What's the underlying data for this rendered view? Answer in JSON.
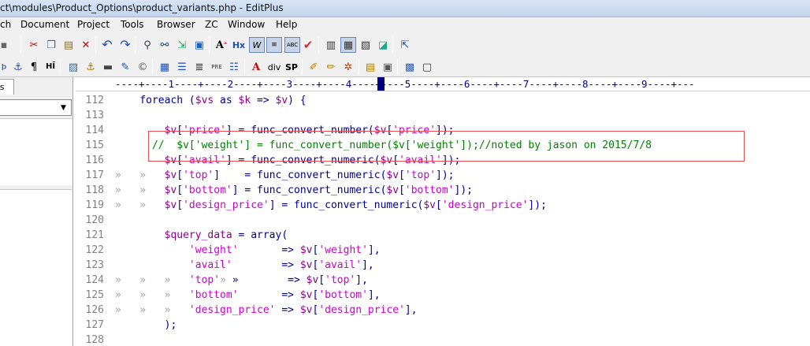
{
  "titlebar": {
    "title": "ct\\modules\\Product_Options\\product_variants.php - EditPlus"
  },
  "menu": [
    "ch",
    "Document",
    "Project",
    "Tools",
    "Browser",
    "ZC",
    "Window",
    "Help"
  ],
  "left_panel": {
    "tab_label": "ons"
  },
  "ruler": {
    "text": "----+----1----+----2----+----3----+----4----+----5----+----6----+----7----+----8----+----9----+---"
  },
  "code": {
    "lines": [
      {
        "num": "112",
        "tabs": "",
        "segs": [
          [
            "k",
            "    foreach ("
          ],
          [
            "v",
            "$vs"
          ],
          [
            "k",
            " as "
          ],
          [
            "v",
            "$k"
          ],
          [
            "k",
            " => "
          ],
          [
            "v",
            "$v"
          ],
          [
            "k",
            ") {"
          ]
        ]
      },
      {
        "num": "113",
        "tabs": "",
        "segs": []
      },
      {
        "num": "114",
        "tabs": "",
        "segs": [
          [
            "v",
            "        $v"
          ],
          [
            "k",
            "["
          ],
          [
            "str",
            "'price'"
          ],
          [
            "k",
            "] = func_convert_number("
          ],
          [
            "v",
            "$v"
          ],
          [
            "k",
            "["
          ],
          [
            "str",
            "'price'"
          ],
          [
            "k",
            "]);"
          ]
        ]
      },
      {
        "num": "115",
        "tabs": "",
        "segs": [
          [
            "c",
            "      //  $v['weight'] = func_convert_number($v['weight']);//noted by jason on 2015/7/8"
          ]
        ]
      },
      {
        "num": "116",
        "tabs": "",
        "segs": [
          [
            "v",
            "        $v"
          ],
          [
            "k",
            "["
          ],
          [
            "str",
            "'avail'"
          ],
          [
            "k",
            "] = func_convert_numeric("
          ],
          [
            "v",
            "$v"
          ],
          [
            "k",
            "["
          ],
          [
            "str",
            "'avail'"
          ],
          [
            "k",
            "]);"
          ]
        ]
      },
      {
        "num": "117",
        "tabs": "»   »",
        "segs": [
          [
            "v",
            "        $v"
          ],
          [
            "k",
            "["
          ],
          [
            "str",
            "'top'"
          ],
          [
            "k",
            "]    = func_convert_numeric("
          ],
          [
            "v",
            "$v"
          ],
          [
            "k",
            "["
          ],
          [
            "str",
            "'top'"
          ],
          [
            "k",
            "]);"
          ]
        ]
      },
      {
        "num": "118",
        "tabs": "»   »",
        "segs": [
          [
            "v",
            "        $v"
          ],
          [
            "k",
            "["
          ],
          [
            "str",
            "'bottom'"
          ],
          [
            "k",
            "] = func_convert_numeric("
          ],
          [
            "v",
            "$v"
          ],
          [
            "k",
            "["
          ],
          [
            "str",
            "'bottom'"
          ],
          [
            "k",
            "]);"
          ]
        ]
      },
      {
        "num": "119",
        "tabs": "»   »",
        "segs": [
          [
            "v",
            "        $v"
          ],
          [
            "k",
            "["
          ],
          [
            "str",
            "'design_price'"
          ],
          [
            "k",
            "] = func_convert_numeric("
          ],
          [
            "v",
            "$v"
          ],
          [
            "k",
            "["
          ],
          [
            "str",
            "'design_price'"
          ],
          [
            "k",
            "]);"
          ]
        ]
      },
      {
        "num": "120",
        "tabs": "",
        "segs": []
      },
      {
        "num": "121",
        "tabs": "",
        "segs": [
          [
            "v",
            "        $query_data"
          ],
          [
            "k",
            " = array("
          ]
        ]
      },
      {
        "num": "122",
        "tabs": "",
        "segs": [
          [
            "str",
            "            'weight'"
          ],
          [
            "k",
            "       => "
          ],
          [
            "v",
            "$v"
          ],
          [
            "k",
            "["
          ],
          [
            "str",
            "'weight'"
          ],
          [
            "k",
            "],"
          ]
        ]
      },
      {
        "num": "123",
        "tabs": "",
        "segs": [
          [
            "str",
            "            'avail'"
          ],
          [
            "k",
            "        => "
          ],
          [
            "v",
            "$v"
          ],
          [
            "k",
            "["
          ],
          [
            "str",
            "'avail'"
          ],
          [
            "k",
            "],"
          ]
        ]
      },
      {
        "num": "124",
        "tabs": "»   »   »",
        "segs": [
          [
            "str",
            "            'top'"
          ],
          [
            "tab",
            "» "
          ],
          [
            "k",
            "  »        => "
          ],
          [
            "v",
            "$v"
          ],
          [
            "k",
            "["
          ],
          [
            "str",
            "'top'"
          ],
          [
            "k",
            "],"
          ]
        ]
      },
      {
        "num": "125",
        "tabs": "»   »   »",
        "segs": [
          [
            "str",
            "            'bottom'"
          ],
          [
            "k",
            "       => "
          ],
          [
            "v",
            "$v"
          ],
          [
            "k",
            "["
          ],
          [
            "str",
            "'bottom'"
          ],
          [
            "k",
            "],"
          ]
        ]
      },
      {
        "num": "126",
        "tabs": "»   »   »",
        "segs": [
          [
            "str",
            "            'design_price'"
          ],
          [
            "k",
            " => "
          ],
          [
            "v",
            "$v"
          ],
          [
            "k",
            "["
          ],
          [
            "str",
            "'design_price'"
          ],
          [
            "k",
            "],"
          ]
        ]
      },
      {
        "num": "127",
        "tabs": "",
        "segs": [
          [
            "k",
            "        );"
          ]
        ]
      },
      {
        "num": "128",
        "tabs": "",
        "segs": []
      }
    ]
  },
  "toolbar1_icons": [
    "cut-icon",
    "copy-icon",
    "paste-icon",
    "delete-icon",
    "undo-icon",
    "redo-icon",
    "find-icon",
    "replace-icon",
    "goto-icon",
    "find-in-files-icon",
    "font-icon",
    "html-heading-icon",
    "word-wrap-icon",
    "line-number-icon",
    "ruler-icon",
    "spellcheck-icon",
    "directory-window-icon",
    "output-window-icon",
    "cliptext-icon",
    "browser-icon",
    "help-icon"
  ],
  "toolbar2_icons": [
    "indent-icon",
    "anchor-icon",
    "paragraph-icon",
    "hr-icon",
    "image-icon",
    "anchor-link-icon",
    "underline-icon",
    "bold-icon",
    "color-icon",
    "table-icon",
    "list-icon",
    "center-icon",
    "pre-icon",
    "list2-icon",
    "font-size-icon",
    "div-icon",
    "span-icon",
    "edit-icon",
    "pencil-icon",
    "debug-icon",
    "document-icon",
    "preview-icon",
    "window-icon",
    "output-icon"
  ]
}
